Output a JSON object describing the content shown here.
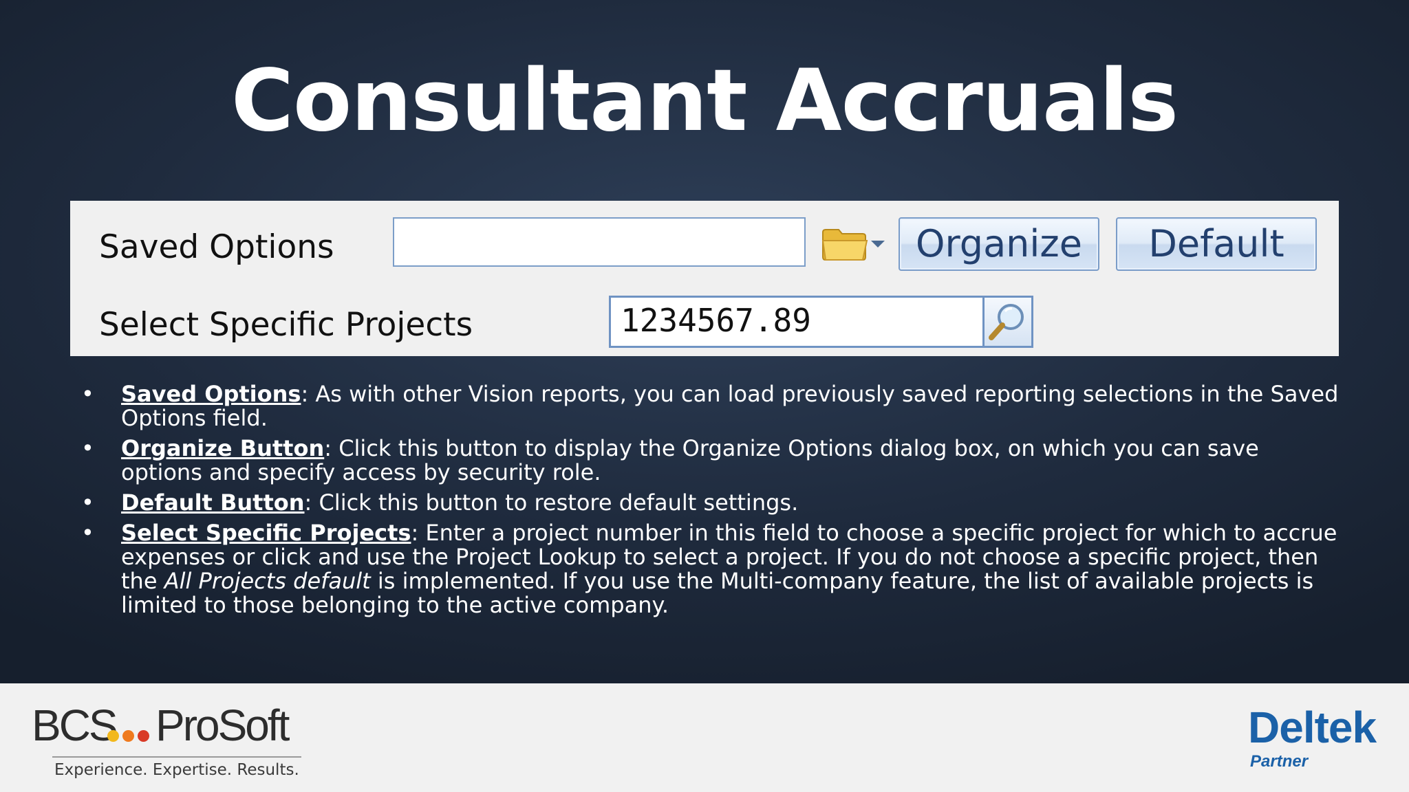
{
  "slide": {
    "title": "Consultant Accruals"
  },
  "panel": {
    "saved_options_label": "Saved Options",
    "saved_options_value": "",
    "organize_label": "Organize",
    "default_label": "Default",
    "select_projects_label": "Select Specific Projects",
    "select_projects_value": "1234567.89"
  },
  "bullets": [
    {
      "term": "Saved Options",
      "text": ": As with other Vision reports, you can load previously saved reporting selections in the Saved Options field."
    },
    {
      "term": "Organize Button",
      "text": ": Click this button to display the Organize Options dialog box, on which you can save options and specify access by security role."
    },
    {
      "term": "Default Button",
      "text": ": Click this button to restore default settings."
    },
    {
      "term": "Select Specific Projects",
      "text_before": ": Enter a project number in this field to choose a specific project for which to accrue expenses or click and use the Project Lookup to select a project. If you do not choose a specific project, then the ",
      "text_italic": "All Projects default",
      "text_after": " is implemented. If you use the Multi-company feature, the list of available projects is limited to those belonging to the active company."
    }
  ],
  "footer": {
    "bcs_left": "BCS",
    "bcs_right": "ProSoft",
    "bcs_tagline": "Experience. Expertise. Results.",
    "deltek": "Deltek",
    "partner": "Partner"
  },
  "colors": {
    "slide_bg": "#1f2b3e",
    "button_text": "#23406e",
    "deltek_blue": "#1b61a8",
    "dot_yellow": "#f2b81c",
    "dot_orange": "#ef7a1e",
    "dot_red": "#d93a26"
  },
  "icons": [
    "folder-icon",
    "dropdown-arrow-icon",
    "magnifier-icon"
  ]
}
